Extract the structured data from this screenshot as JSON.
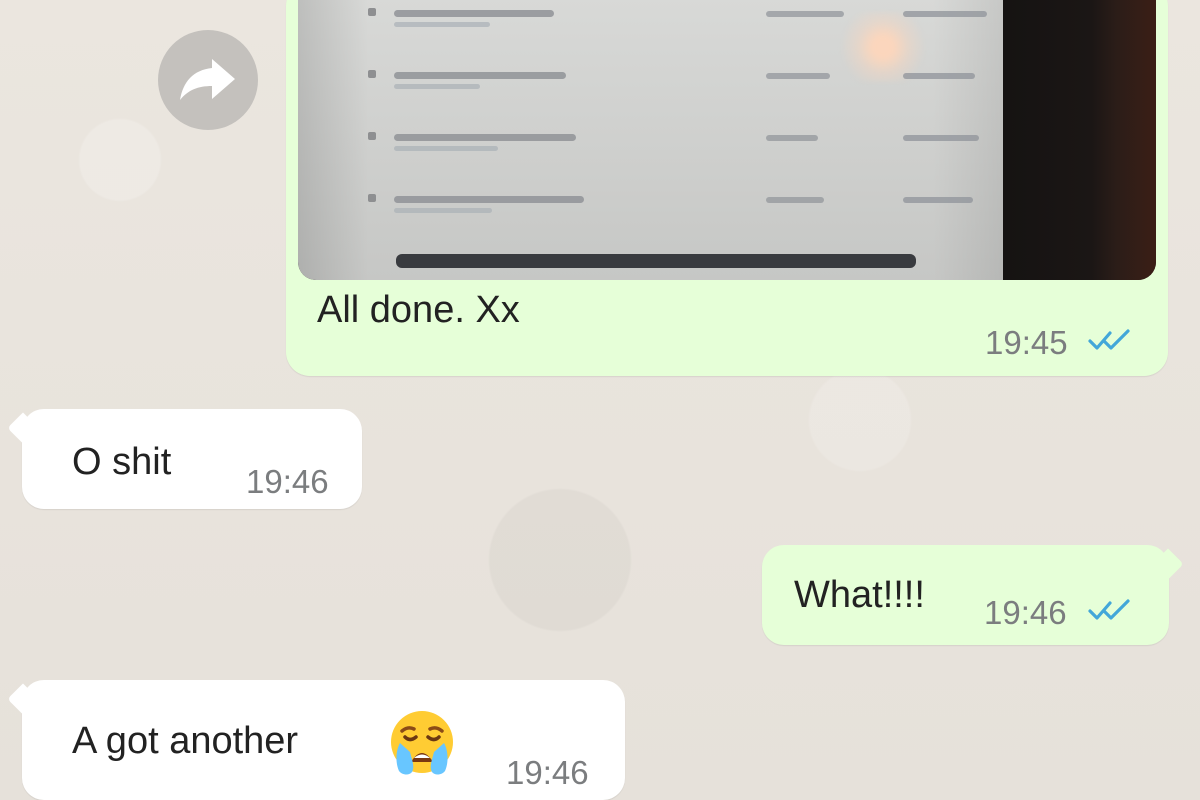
{
  "chat": {
    "forward_icon": "forward-arrow-icon",
    "media_message": {
      "caption": "All done. Xx",
      "time": "19:45",
      "status_icon": "double-check-read-icon"
    },
    "incoming_1": {
      "text": "O shit",
      "time": "19:46"
    },
    "outgoing_1": {
      "text": "What!!!!",
      "time": "19:46",
      "status_icon": "double-check-read-icon"
    },
    "incoming_2": {
      "text": "A got another",
      "time": "19:46",
      "emoji": "crying-face-emoji"
    }
  },
  "colors": {
    "wallpaper": "#e9e4de",
    "incoming_bubble": "#ffffff",
    "outgoing_bubble": "#e6ffd8",
    "read_receipt": "#43a7d9",
    "forward_button": "#c4c1bd"
  }
}
